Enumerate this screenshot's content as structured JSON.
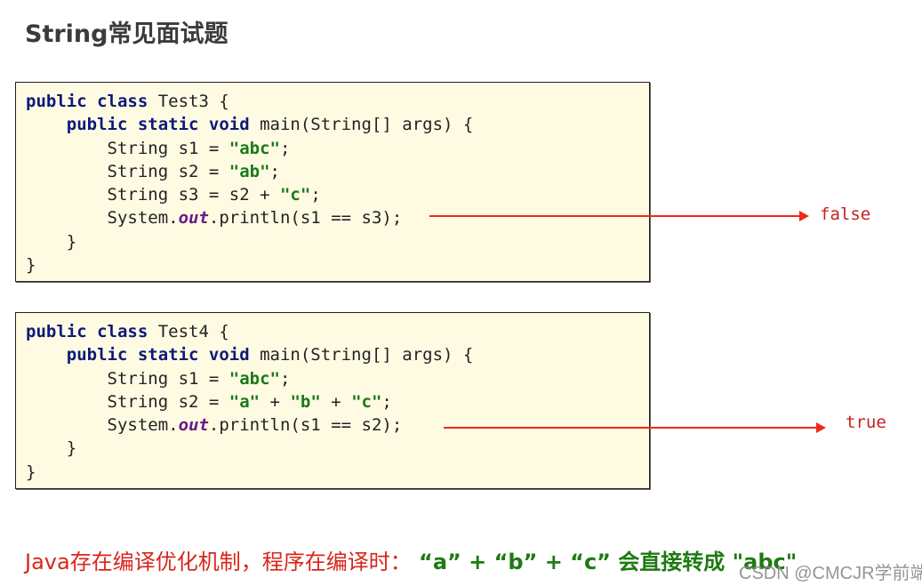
{
  "page": {
    "title": "String常见面试题"
  },
  "examples": [
    {
      "class_name": "Test3",
      "lines": [
        [
          "kw:public class ",
          "txt:Test3 {"
        ],
        [
          "txt:    ",
          "kw:public static void ",
          "txt:main(String[] args) {"
        ],
        [
          "txt:        String s1 = ",
          "str:\"abc\"",
          "txt:;"
        ],
        [
          "txt:        String s2 = ",
          "str:\"ab\"",
          "txt:;"
        ],
        [
          "txt:        String s3 = s2 + ",
          "str:\"c\"",
          "txt:;"
        ],
        [
          "txt:        System.",
          "fld:out",
          "txt:.println(s1 == s3);"
        ],
        [
          "txt:    }"
        ],
        [
          "txt:}"
        ]
      ],
      "result": "false"
    },
    {
      "class_name": "Test4",
      "lines": [
        [
          "kw:public class ",
          "txt:Test4 {"
        ],
        [
          "txt:    ",
          "kw:public static void ",
          "txt:main(String[] args) {"
        ],
        [
          "txt:        String s1 = ",
          "str:\"abc\"",
          "txt:;"
        ],
        [
          "txt:        String s2 = ",
          "str:\"a\"",
          "txt: + ",
          "str:\"b\"",
          "txt: + ",
          "str:\"c\"",
          "txt:;"
        ],
        [
          "txt:        System.",
          "fld:out",
          "txt:.println(s1 == s2);"
        ],
        [
          "txt:    }"
        ],
        [
          "txt:}"
        ]
      ],
      "result": "true"
    }
  ],
  "note": {
    "prefix": "Java存在编译优化机制，程序在编译时：",
    "expression": " “a” + “b” + “c” 会直接转成 \"abc\""
  },
  "watermark": "CSDN @CMCJR学前端",
  "colors": {
    "keyword": "#0d1a7a",
    "string": "#1a7a1a",
    "field": "#6a1a8a",
    "arrow": "#ee2a1a",
    "result": "#c6211f",
    "code_bg": "#fffbe3"
  }
}
